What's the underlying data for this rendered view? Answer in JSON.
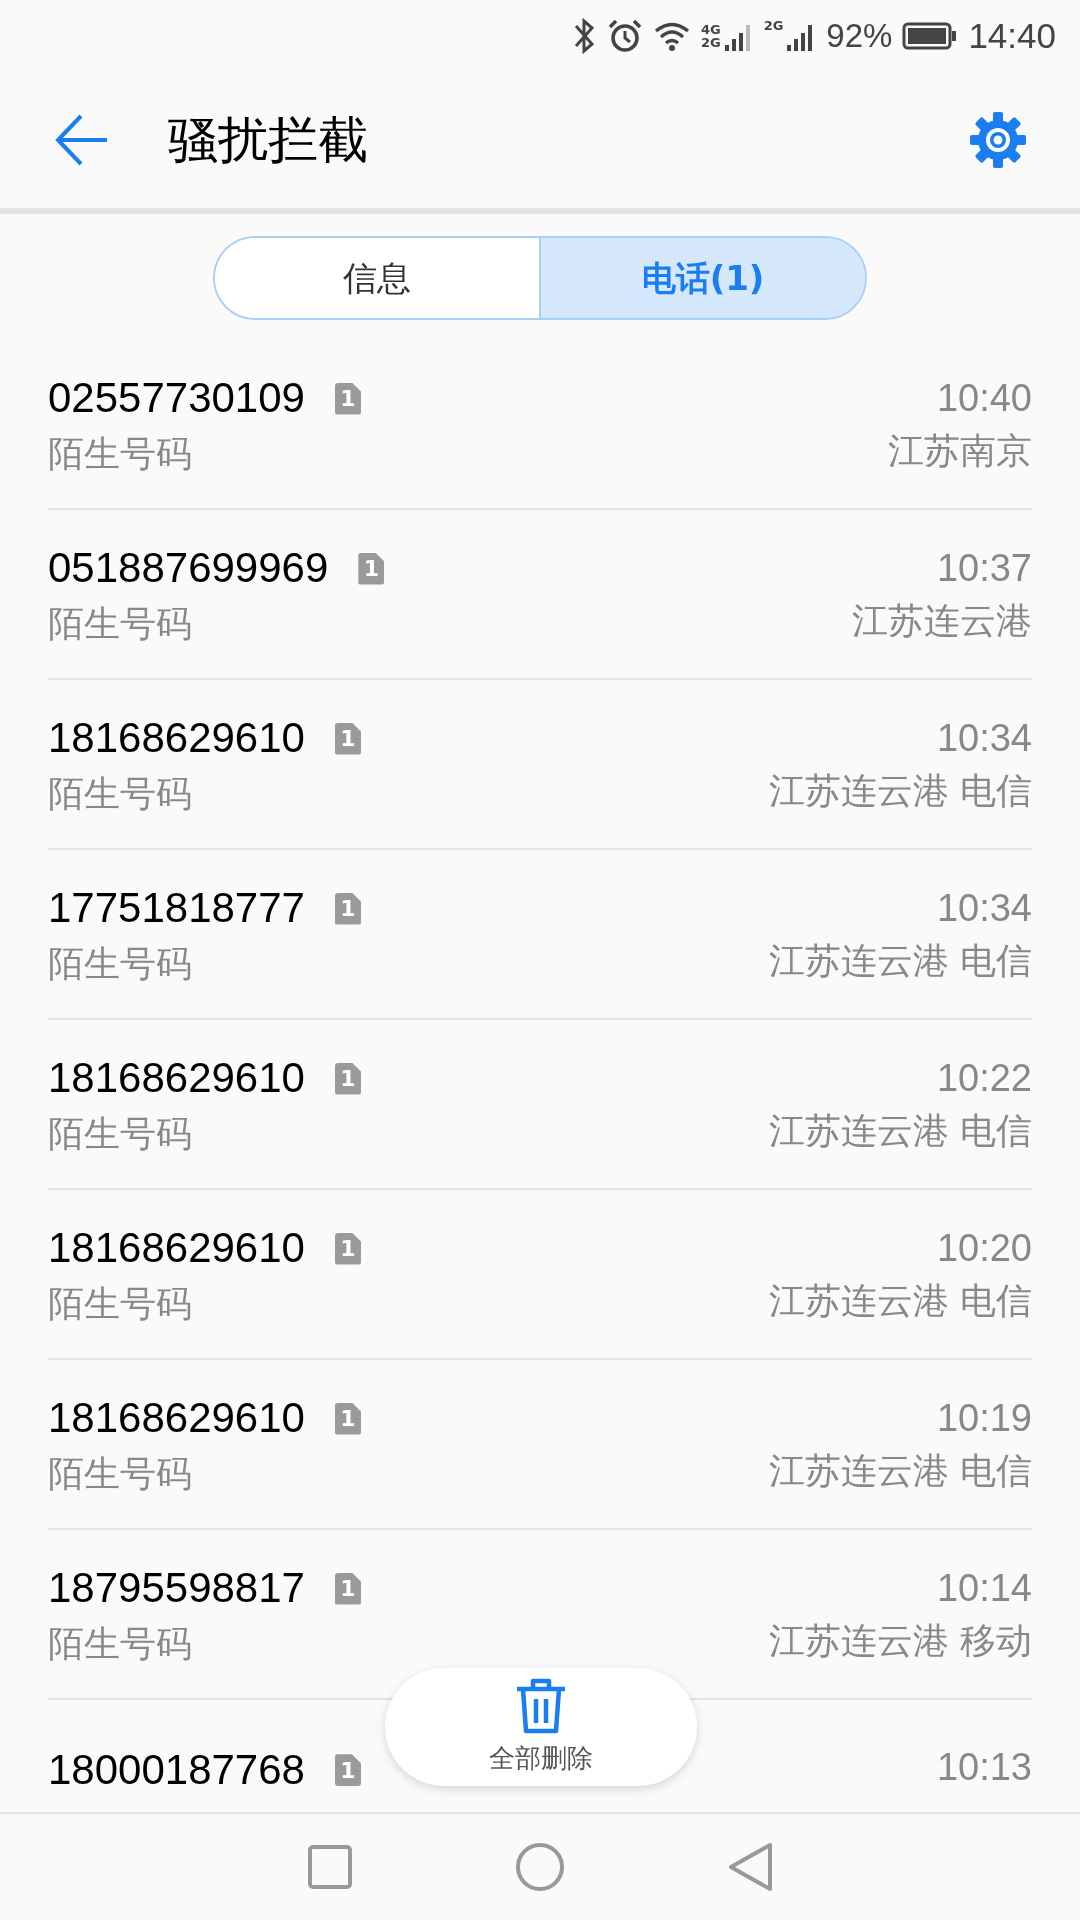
{
  "status_bar": {
    "battery": "92%",
    "time": "14:40",
    "network_1": "4G",
    "network_2": "2G",
    "network_3": "2G"
  },
  "header": {
    "title": "骚扰拦截"
  },
  "tabs": [
    {
      "label": "信息",
      "selected": false
    },
    {
      "label": "电话(1)",
      "selected": true
    }
  ],
  "calls": [
    {
      "number": "02557730109",
      "sim": "1",
      "label": "陌生号码",
      "time": "10:40",
      "location": "江苏南京"
    },
    {
      "number": "051887699969",
      "sim": "1",
      "label": "陌生号码",
      "time": "10:37",
      "location": "江苏连云港"
    },
    {
      "number": "18168629610",
      "sim": "1",
      "label": "陌生号码",
      "time": "10:34",
      "location": "江苏连云港 电信"
    },
    {
      "number": "17751818777",
      "sim": "1",
      "label": "陌生号码",
      "time": "10:34",
      "location": "江苏连云港 电信"
    },
    {
      "number": "18168629610",
      "sim": "1",
      "label": "陌生号码",
      "time": "10:22",
      "location": "江苏连云港 电信"
    },
    {
      "number": "18168629610",
      "sim": "1",
      "label": "陌生号码",
      "time": "10:20",
      "location": "江苏连云港 电信"
    },
    {
      "number": "18168629610",
      "sim": "1",
      "label": "陌生号码",
      "time": "10:19",
      "location": "江苏连云港 电信"
    },
    {
      "number": "18795598817",
      "sim": "1",
      "label": "陌生号码",
      "time": "10:14",
      "location": "江苏连云港 移动"
    },
    {
      "number": "18000187768",
      "sim": "1",
      "time": "10:13"
    }
  ],
  "delete_all": {
    "label": "全部删除"
  }
}
